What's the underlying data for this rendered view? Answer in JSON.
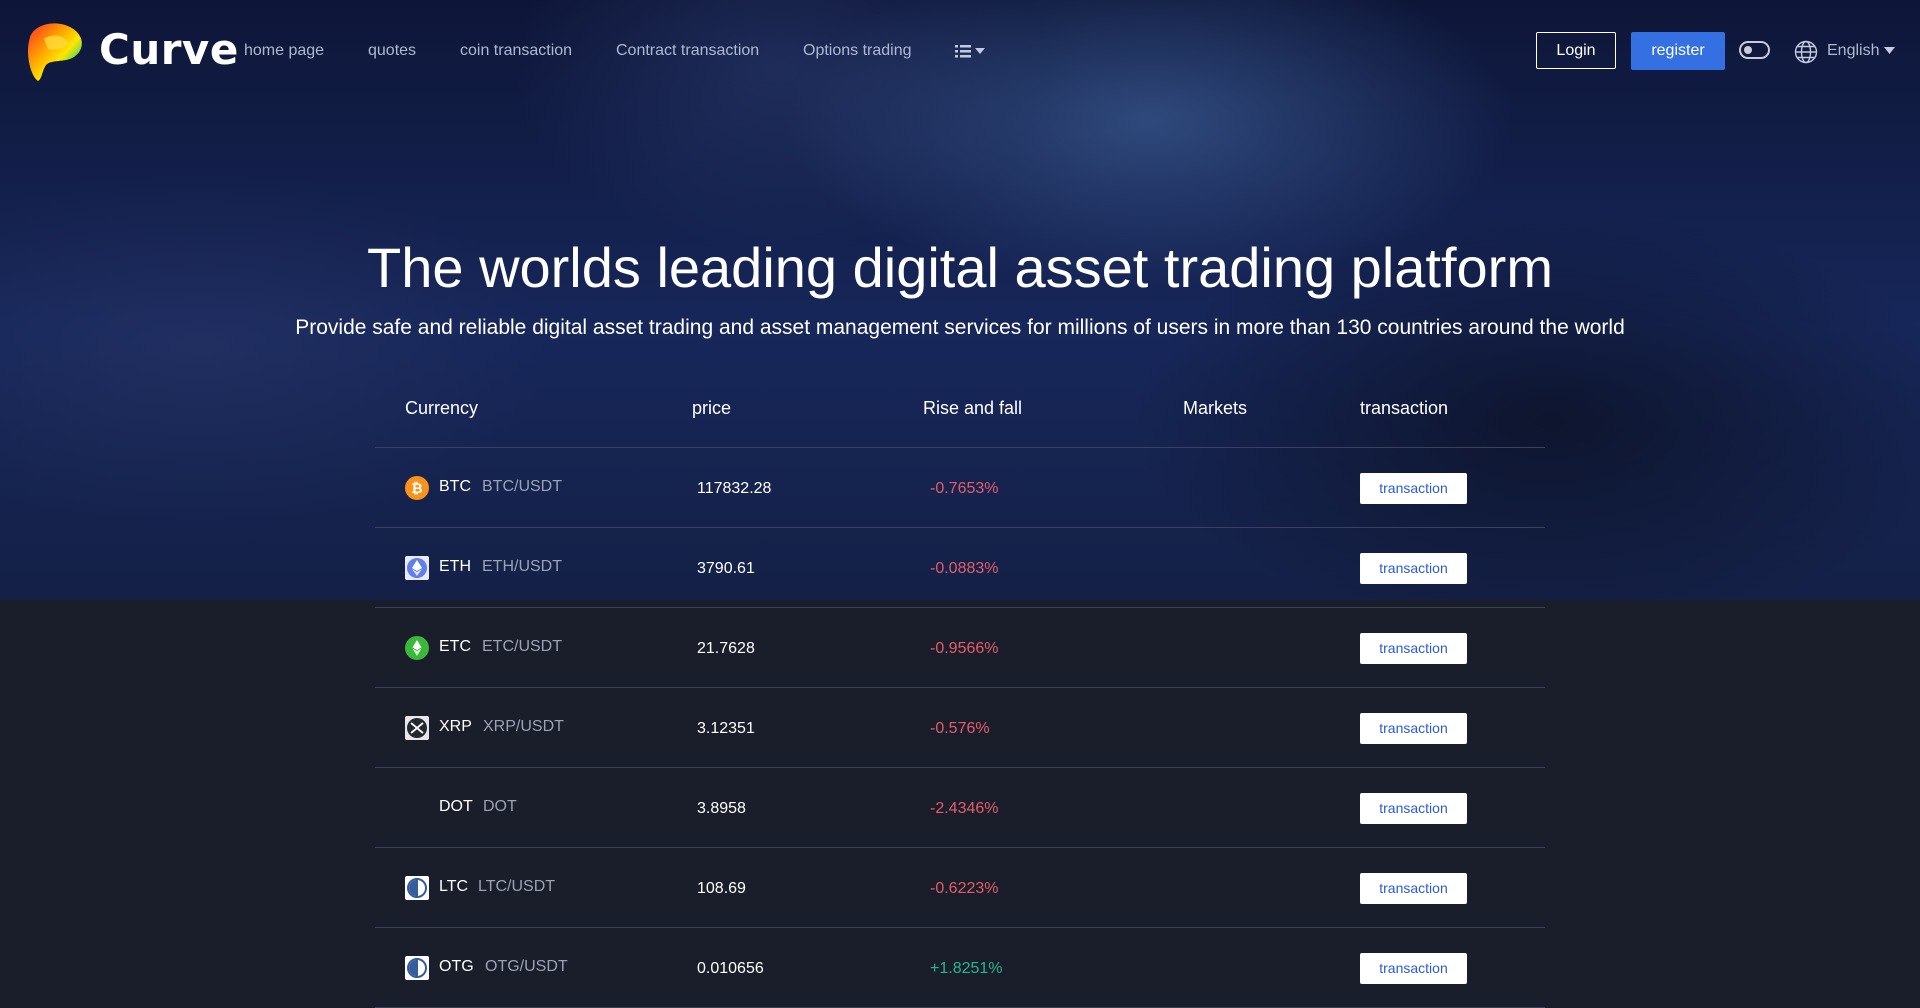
{
  "nav": {
    "brand": "Curve",
    "links": [
      "home page",
      "quotes",
      "coin transaction",
      "Contract transaction",
      "Options trading"
    ],
    "login_label": "Login",
    "register_label": "register",
    "language": "English"
  },
  "hero": {
    "title": "The worlds leading digital asset trading platform",
    "subtitle": "Provide safe and reliable digital asset trading and asset management services for millions of users in more than 130 countries around the world"
  },
  "table": {
    "headers": [
      "Currency",
      "price",
      "Rise and fall",
      "Markets",
      "transaction"
    ],
    "rows": [
      {
        "symbol": "BTC",
        "pair": "BTC/USDT",
        "price": "117832.28",
        "change": "-0.7653%",
        "direction": "down",
        "icon": "bitcoin-icon",
        "action": "transaction"
      },
      {
        "symbol": "ETH",
        "pair": "ETH/USDT",
        "price": "3790.61",
        "change": "-0.0883%",
        "direction": "down",
        "icon": "ethereum-icon",
        "action": "transaction"
      },
      {
        "symbol": "ETC",
        "pair": "ETC/USDT",
        "price": "21.7628",
        "change": "-0.9566%",
        "direction": "down",
        "icon": "ethereum-classic-icon",
        "action": "transaction"
      },
      {
        "symbol": "XRP",
        "pair": "XRP/USDT",
        "price": "3.12351",
        "change": "-0.576%",
        "direction": "down",
        "icon": "xrp-icon",
        "action": "transaction"
      },
      {
        "symbol": "DOT",
        "pair": "DOT",
        "price": "3.8958",
        "change": "-2.4346%",
        "direction": "down",
        "icon": "none",
        "action": "transaction"
      },
      {
        "symbol": "LTC",
        "pair": "LTC/USDT",
        "price": "108.69",
        "change": "-0.6223%",
        "direction": "down",
        "icon": "litecoin-icon",
        "action": "transaction"
      },
      {
        "symbol": "OTG",
        "pair": "OTG/USDT",
        "price": "0.010656",
        "change": "+1.8251%",
        "direction": "up",
        "icon": "otg-coin-icon",
        "action": "transaction"
      }
    ]
  },
  "colors": {
    "accent": "#3470e2",
    "down": "#e35d69",
    "up": "#24b78f",
    "page_background": "#1a1d2a",
    "hero_background": "#142046"
  }
}
